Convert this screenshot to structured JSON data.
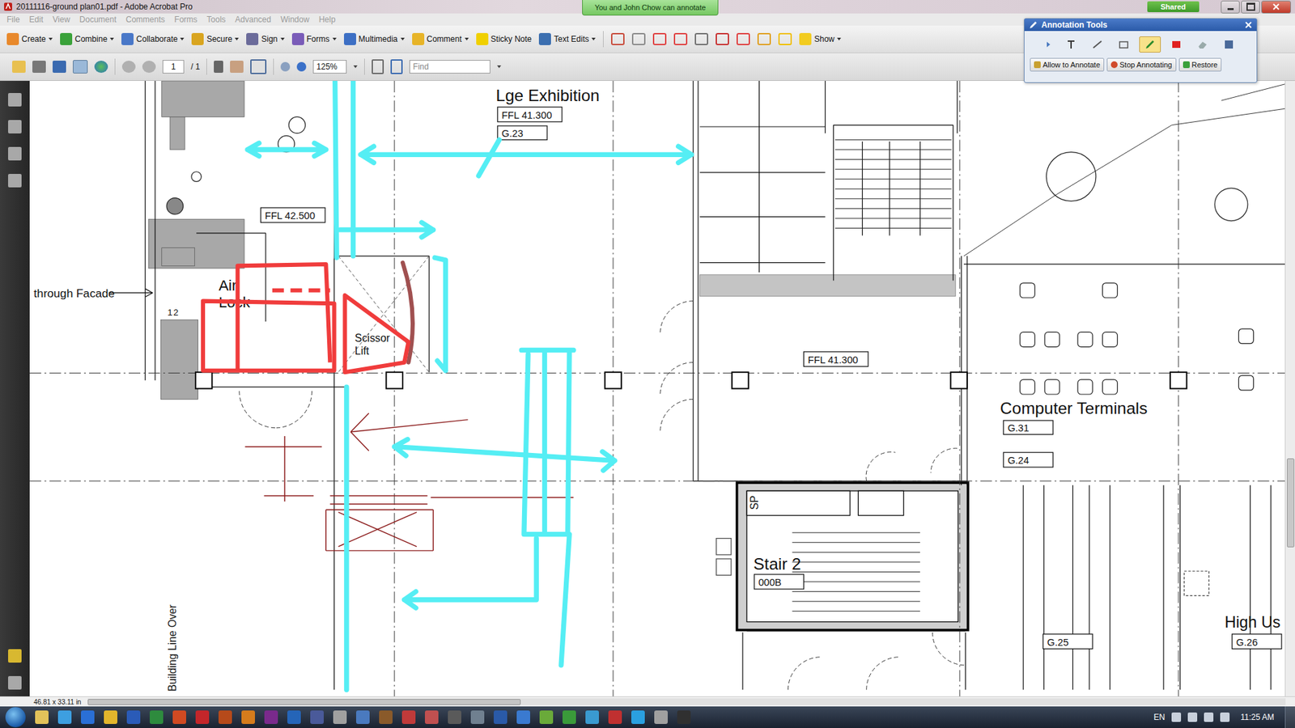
{
  "window": {
    "title": "20111116-ground plan01.pdf - Adobe Acrobat Pro",
    "notice": "You and John Chow can annotate",
    "shared": "Shared"
  },
  "menu": [
    {
      "label": "File",
      "disabled": true
    },
    {
      "label": "Edit",
      "disabled": true
    },
    {
      "label": "View",
      "disabled": true
    },
    {
      "label": "Document",
      "disabled": true
    },
    {
      "label": "Comments",
      "disabled": true
    },
    {
      "label": "Forms",
      "disabled": true
    },
    {
      "label": "Tools",
      "disabled": true
    },
    {
      "label": "Advanced",
      "disabled": true
    },
    {
      "label": "Window",
      "disabled": true
    },
    {
      "label": "Help",
      "disabled": true
    }
  ],
  "toolbar": [
    {
      "label": "Create",
      "dropdown": true
    },
    {
      "label": "Combine",
      "dropdown": true
    },
    {
      "label": "Collaborate",
      "dropdown": true
    },
    {
      "label": "Secure",
      "dropdown": true
    },
    {
      "label": "Sign",
      "dropdown": true
    },
    {
      "label": "Forms",
      "dropdown": true
    },
    {
      "label": "Multimedia",
      "dropdown": true
    },
    {
      "label": "Comment",
      "dropdown": true
    },
    {
      "label": "Sticky Note",
      "dropdown": false
    },
    {
      "label": "Text Edits",
      "dropdown": true
    }
  ],
  "toolbar_show": {
    "label": "Show",
    "dropdown": true
  },
  "navigation": {
    "page": "1",
    "pages": "/ 1",
    "zoom": "125%",
    "find_placeholder": "Find"
  },
  "annotation_tools": {
    "title": "Annotation Tools",
    "tools": [
      {
        "selected": false
      },
      {
        "selected": false
      },
      {
        "selected": false
      },
      {
        "selected": false
      },
      {
        "selected": true
      },
      {
        "selected": false
      },
      {
        "selected": false
      },
      {
        "selected": false
      }
    ],
    "buttons": [
      "Allow to Annotate",
      "Stop Annotating",
      "Restore"
    ]
  },
  "plan": {
    "labels": [
      {
        "text": "Lge Exhibition",
        "kind": "text"
      },
      {
        "text": "FFL  41.300",
        "kind": "tag"
      },
      {
        "text": "G.23",
        "kind": "tag"
      },
      {
        "text": "FFL  42.500",
        "kind": "tag"
      },
      {
        "text": "Air",
        "kind": "text"
      },
      {
        "text": "Lock",
        "kind": "text"
      },
      {
        "text": "through Facade",
        "kind": "text"
      },
      {
        "text": "1",
        "kind": "text"
      },
      {
        "text": "2",
        "kind": "text"
      },
      {
        "text": "Scissor",
        "kind": "text"
      },
      {
        "text": "Lift",
        "kind": "text"
      },
      {
        "text": "FFL 41.300",
        "kind": "tag"
      },
      {
        "text": "Computer Terminals",
        "kind": "text"
      },
      {
        "text": "G.31",
        "kind": "tag"
      },
      {
        "text": "G.24",
        "kind": "tag"
      },
      {
        "text": "SP",
        "kind": "vertical"
      },
      {
        "text": "Stair 2",
        "kind": "text"
      },
      {
        "text": "000B",
        "kind": "tag"
      },
      {
        "text": "G.25",
        "kind": "tag"
      },
      {
        "text": "High Us",
        "kind": "text"
      },
      {
        "text": "G.26",
        "kind": "tag"
      },
      {
        "text": "Building Line Over",
        "kind": "vertical"
      }
    ]
  },
  "status_bar": {
    "page_size": "46.81 x 33.11 in"
  },
  "taskbar": {
    "language": "EN",
    "time": "11:25 AM"
  }
}
